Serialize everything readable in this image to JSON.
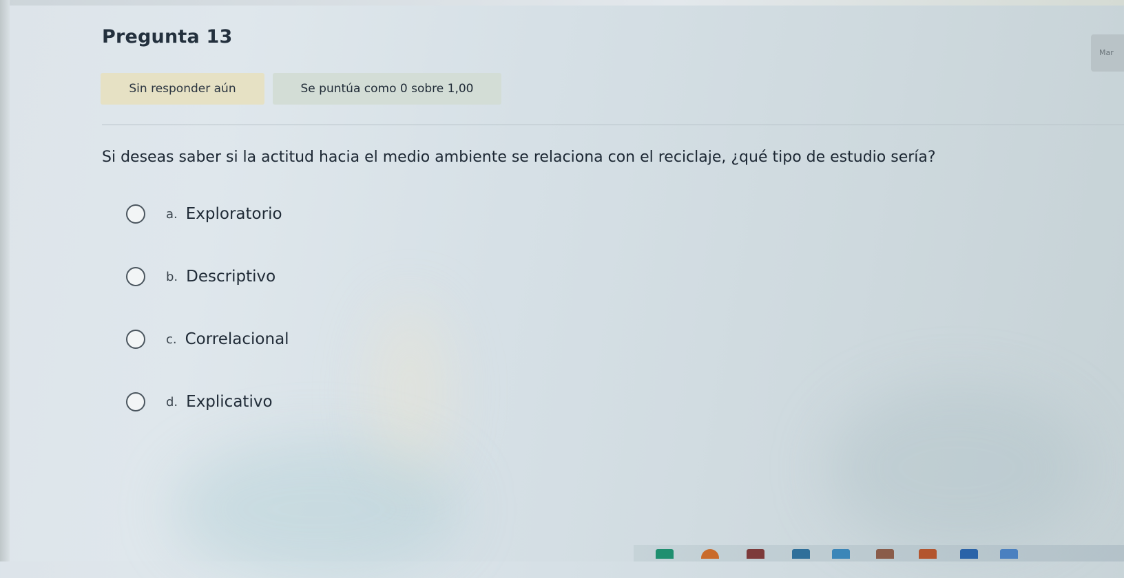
{
  "question": {
    "title": "Pregunta 13",
    "status": "Sin responder aún",
    "grade": "Se puntúa como 0 sobre 1,00",
    "flag_label": "Mar",
    "text": "Si deseas saber si la actitud hacia el medio ambiente se relaciona con el reciclaje, ¿qué tipo de estudio sería?",
    "options": [
      {
        "letter": "a.",
        "label": "Exploratorio"
      },
      {
        "letter": "b.",
        "label": "Descriptivo"
      },
      {
        "letter": "c.",
        "label": "Correlacional"
      },
      {
        "letter": "d.",
        "label": "Explicativo"
      }
    ]
  },
  "taskbar": {
    "icons": [
      "file-explorer-icon",
      "chrome-icon",
      "app-icon",
      "mail-icon",
      "store-icon",
      "word-icon",
      "powerpoint-icon",
      "media-icon",
      "outlook-icon"
    ]
  }
}
